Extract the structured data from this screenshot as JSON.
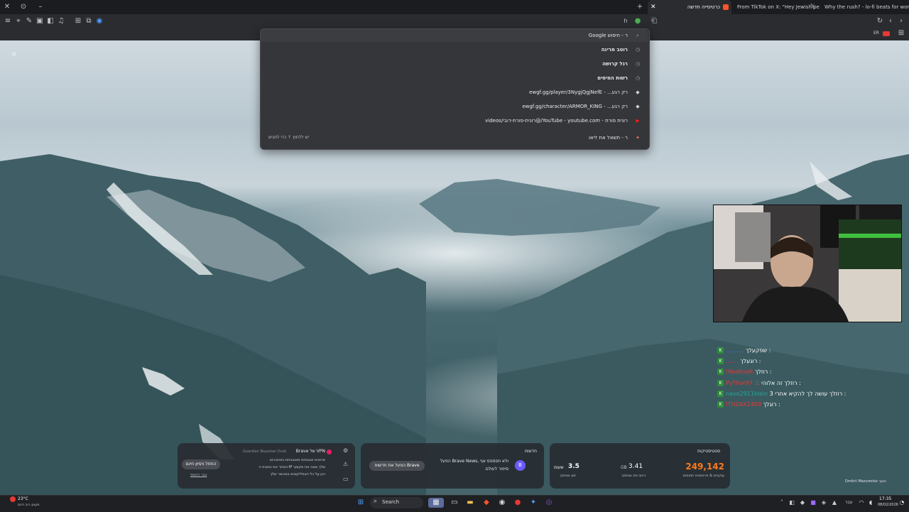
{
  "tabs": [
    {
      "title": "כרטיסייה חדשה",
      "active": true
    },
    {
      "title": "From TikTok on X: \"Hey Jewish peopl...",
      "active": false
    },
    {
      "title": "Why the rush? - lo-fi beats for work...",
      "active": false
    }
  ],
  "toolbar": {
    "search_glyph": "h",
    "profile_initials": "ER"
  },
  "omnibox": {
    "input_value": "",
    "first_row": "ר - חיפוש Google",
    "suggestions": [
      {
        "text": "רוטב מרינה",
        "icon": "clock-icon",
        "bold": true
      },
      {
        "text": "רגל קרושה",
        "icon": "clock-icon",
        "bold": true
      },
      {
        "text": "רשות המיסים",
        "icon": "clock-icon",
        "bold": true
      },
      {
        "text": "רק רגע... - ewgf.gg/player/3NygjQgjNefE",
        "icon": "favicon-ewgf",
        "bold": false
      },
      {
        "text": "רק רגע... - ewgf.gg/character/ARMOR_KING",
        "icon": "favicon-ewgf",
        "bold": false
      },
      {
        "text": "רונית פורת - YouTube - youtube.com/@רונית-פורת-דובי/videos",
        "icon": "youtube-icon",
        "bold": false
      },
      {
        "text": "ר - תשאל את ליאו",
        "icon": "leo-icon",
        "bold": false
      }
    ],
    "hint": "יש ללחוץ ↑ כדי לתגיש"
  },
  "chat": [
    {
      "name": "..........",
      "msg": "שפקעלך :",
      "color": "#4b6cff"
    },
    {
      "name": ".......",
      "msg": "רוגעלך :",
      "color": "#e91e63"
    },
    {
      "name": "!RedlineR",
      "msg": "רוזלך :",
      "color": "#e53935"
    },
    {
      "name": "PyThor97 :L",
      "msg": "רוזלך זה אלוהי :",
      "color": "#e53935"
    },
    {
      "name": "nevo2911klein",
      "msg": "רוזלך עושה לך להקיא אחרי 3 :",
      "color": "#26a69a"
    },
    {
      "name": "ITHZAX1400",
      "msg": "רוגלך :",
      "color": "#e53935"
    }
  ],
  "cards": {
    "vpn": {
      "title": "Brave של VPN",
      "brand": "Guardian Bayesian Dusk",
      "lines": [
        "פרטיות ואבטחת מאובטחת באינטרנט",
        "הסתר את כתובת ה-IP שלך ושנה את מקומך",
        "הגן על כל האפליקציות במכשיר שלך"
      ],
      "cta": "התחל ניסיון חינם",
      "link": "כבר רכשתי"
    },
    "news": {
      "title": "חדשות",
      "text_line1": "הפעל Brave News, ולא תפספס אף",
      "text_line2": "סיפור לעולם",
      "cta": "הפעל את חדשות Brave"
    },
    "stats": {
      "title": "סטטיסטיקות",
      "blocked_value": "249,142",
      "blocked_label": "עוקבים & פרסומות חסומים",
      "bandwidth_value": "3.41",
      "bandwidth_unit": "GB",
      "bandwidth_label": "רוחב פס שנחסך",
      "time_value": "3.5",
      "time_unit": "שעות",
      "time_label": "זמן שנחסך"
    }
  },
  "credit": "Dmitrii Mazurenko חסוך",
  "taskbar": {
    "weather_temp": "23°C",
    "weather_desc": "מעונן רוב היום",
    "search_label": "Search",
    "time": "17:35",
    "date": "08/02/2026",
    "lang": "עבר"
  },
  "colors": {
    "accent": "#fb542b",
    "stats_orange": "#ff7a1a",
    "news_purple": "#6b5bff"
  }
}
